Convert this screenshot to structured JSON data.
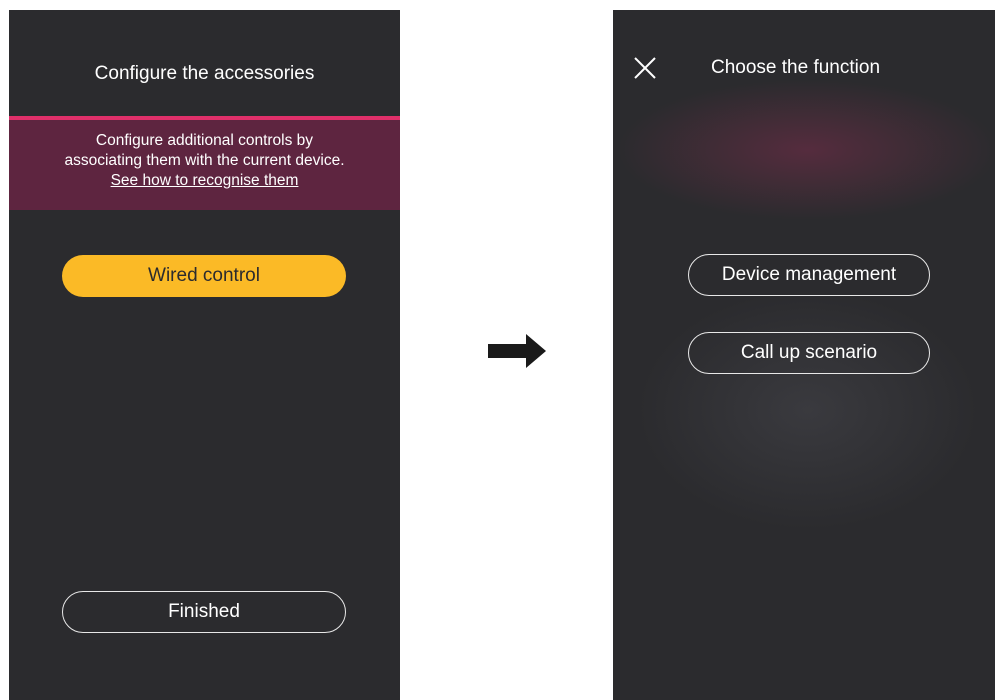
{
  "left_screen": {
    "title": "Configure the accessories",
    "info": {
      "line1": "Configure additional controls by",
      "line2": "associating them with the current device.",
      "link": "See how to recognise them"
    },
    "wired_control_label": "Wired control",
    "finished_label": "Finished"
  },
  "right_screen": {
    "title": "Choose the function",
    "close_icon": "close-icon",
    "options": {
      "device_management": "Device management",
      "call_up_scenario": "Call up scenario"
    }
  },
  "transition_icon": "arrow-right-icon",
  "colors": {
    "screen_bg": "#2b2b2e",
    "accent_yellow": "#fbba26",
    "info_band": "#5e2540",
    "info_border": "#e0306a"
  }
}
